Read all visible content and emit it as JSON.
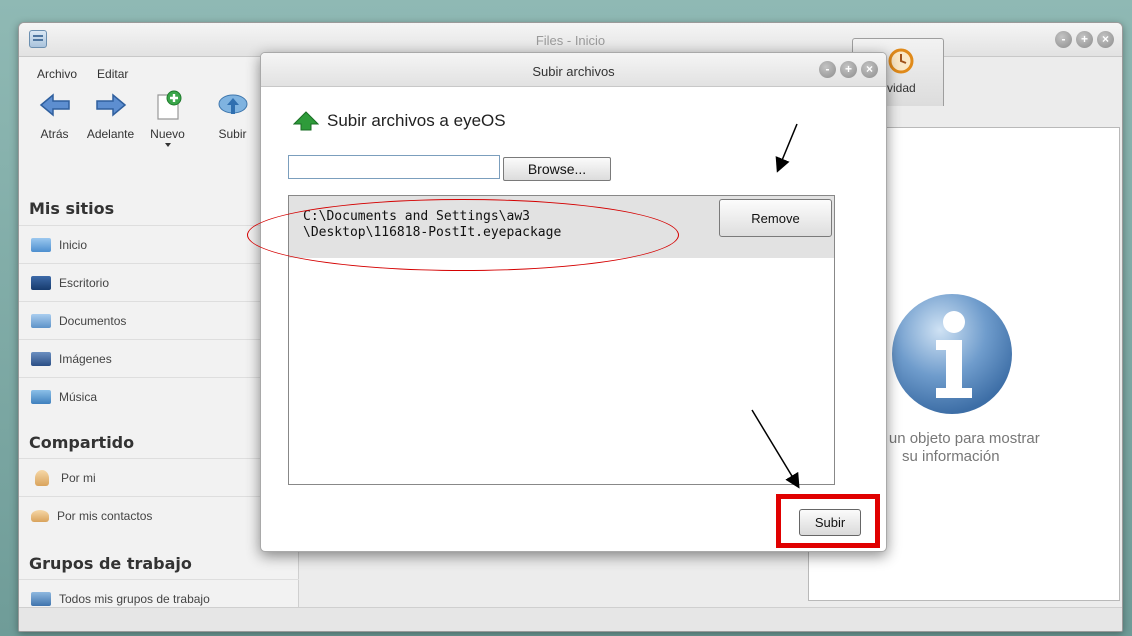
{
  "main_window": {
    "title": "Files - Inicio",
    "window_buttons": [
      "-",
      "+",
      "×"
    ]
  },
  "menu": {
    "archivo": "Archivo",
    "editar": "Editar"
  },
  "toolbar": {
    "back": "Atrás",
    "forward": "Adelante",
    "new": "Nuevo",
    "upload": "Subir"
  },
  "sidebar": {
    "mis_sitios": {
      "title": "Mis sitios",
      "items": [
        {
          "label": "Inicio",
          "icon": "home-folder-icon"
        },
        {
          "label": "Escritorio",
          "icon": "desktop-folder-icon"
        },
        {
          "label": "Documentos",
          "icon": "documents-folder-icon"
        },
        {
          "label": "Imágenes",
          "icon": "images-folder-icon"
        },
        {
          "label": "Música",
          "icon": "music-folder-icon"
        }
      ]
    },
    "compartido": {
      "title": "Compartido",
      "items": [
        {
          "label": "Por mi",
          "icon": "user-icon"
        },
        {
          "label": "Por mis contactos",
          "icon": "contacts-icon"
        }
      ]
    },
    "grupos": {
      "title": "Grupos de trabajo",
      "items": [
        {
          "label": "Todos mis grupos de trabajo",
          "icon": "groups-icon"
        }
      ]
    }
  },
  "right_panel": {
    "tab_label": "Actividad",
    "info_line1": "na un objeto para mostrar",
    "info_line2": "su información"
  },
  "dialog": {
    "title": "Subir archivos",
    "heading": "Subir archivos a eyeOS",
    "browse_label": "Browse...",
    "file_path_line1": "C:\\Documents and Settings\\aw3",
    "file_path_line2": "\\Desktop\\116818-PostIt.eyepackage",
    "remove_label": "Remove",
    "submit_label": "Subir"
  },
  "colors": {
    "annotation_red": "#e00000",
    "accent_green": "#2e9b3a",
    "info_blue": "#4a7fb5"
  }
}
